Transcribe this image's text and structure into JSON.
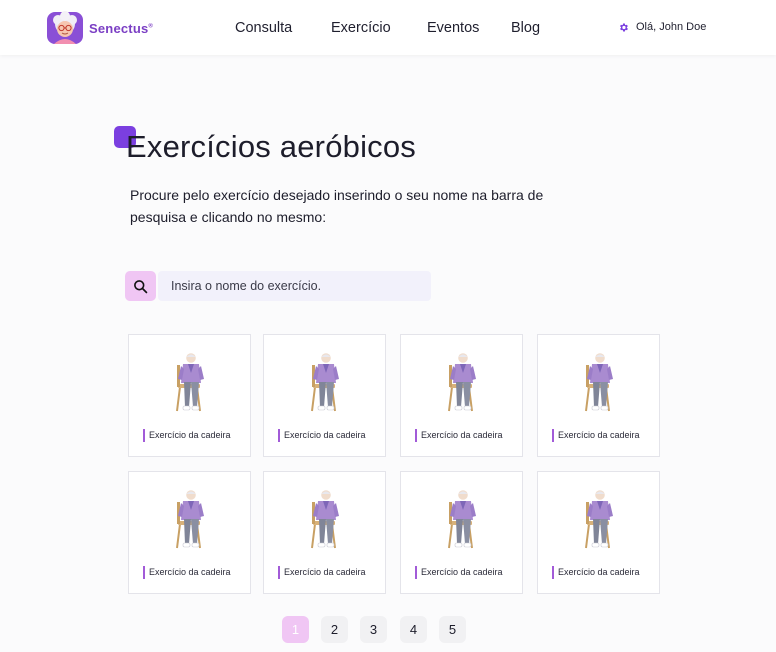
{
  "brand": {
    "name": "Senectus",
    "reg": "®",
    "accent": "#7b3fc4"
  },
  "nav": {
    "consulta": "Consulta",
    "exercicio": "Exercício",
    "eventos": "Eventos",
    "blog": "Blog"
  },
  "user": {
    "greeting": "Olá, John Doe",
    "icon": "gear-icon"
  },
  "page": {
    "title": "Exercícios aeróbicos",
    "intro": "Procure pelo exercício desejado inserindo o seu nome na barra de pesquisa e clicando no mesmo:"
  },
  "search": {
    "placeholder": "Insira o nome do exercício.",
    "value": "",
    "icon": "search-icon"
  },
  "exercises": [
    {
      "label": "Exercício da cadeira"
    },
    {
      "label": "Exercício da cadeira"
    },
    {
      "label": "Exercício da cadeira"
    },
    {
      "label": "Exercício da cadeira"
    },
    {
      "label": "Exercício da cadeira"
    },
    {
      "label": "Exercício da cadeira"
    },
    {
      "label": "Exercício da cadeira"
    },
    {
      "label": "Exercício da cadeira"
    }
  ],
  "pagination": {
    "pages": [
      "1",
      "2",
      "3",
      "4",
      "5"
    ],
    "current": "1"
  },
  "colors": {
    "accent_purple": "#7b3fe0",
    "pink_highlight": "#f0c6f4",
    "search_bg": "#f2f1fb"
  }
}
